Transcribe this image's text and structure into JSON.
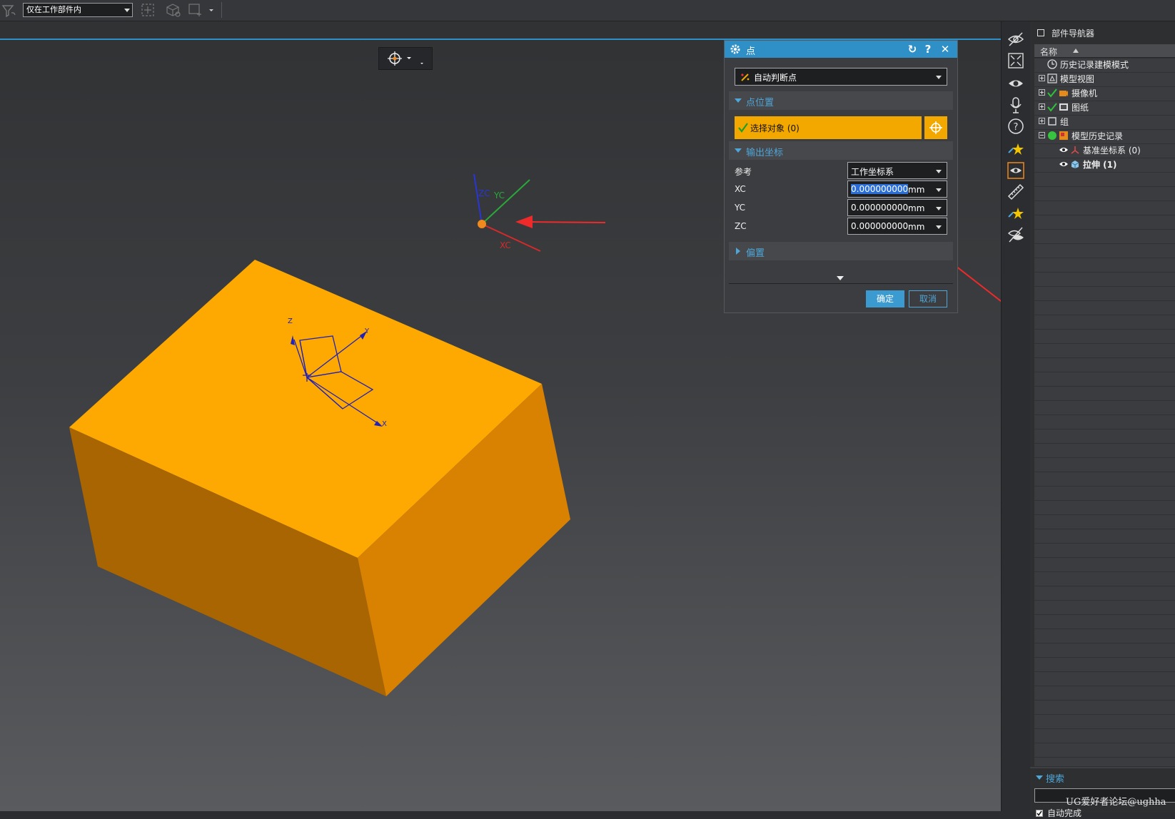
{
  "toolbar": {
    "scope_select": "仅在工作部件内",
    "icons": [
      "selection-filter-icon",
      "snap-point-icon",
      "box-select-icon",
      "rect-select-icon"
    ]
  },
  "viewport": {
    "background_top": "#303234",
    "background_bottom": "#595b5e",
    "accent": "#2f8fc7",
    "model_color": "#f3a800",
    "wcs_labels": {
      "zc": "ZC",
      "yc": "YC",
      "xc": "XC"
    },
    "datum_labels": {
      "z": "Z",
      "y": "Y",
      "x": "X"
    }
  },
  "dialog": {
    "title": "点",
    "point_type": "自动判断点",
    "group_location": "点位置",
    "select_object": "选择对象 (0)",
    "group_output": "输出坐标",
    "reference_label": "参考",
    "reference_value": "工作坐标系",
    "xc_label": "XC",
    "xc_value": "0.000000000",
    "yc_label": "YC",
    "yc_value": "0.000000000",
    "zc_label": "ZC",
    "zc_value": "0.000000000",
    "unit": "mm",
    "group_offset": "偏置",
    "ok_label": "确定",
    "cancel_label": "取消"
  },
  "navigator": {
    "title": "部件导航器",
    "column_name": "名称",
    "items": [
      {
        "label": "历史记录建模模式",
        "icon": "clock-icon"
      },
      {
        "label": "模型视图",
        "icon": "model-views-icon"
      },
      {
        "label": "摄像机",
        "icon": "camera-icon"
      },
      {
        "label": "图纸",
        "icon": "drawing-icon"
      },
      {
        "label": "组",
        "icon": "group-icon"
      },
      {
        "label": "模型历史记录",
        "icon": "model-history-icon"
      },
      {
        "label": "基准坐标系 (0)",
        "icon": "datum-csys-icon"
      },
      {
        "label": "拉伸 (1)",
        "icon": "extrude-icon"
      }
    ],
    "search_label": "搜索",
    "autocomplete_label": "自动完成",
    "watermark": "UG爱好者论坛@ughha"
  }
}
